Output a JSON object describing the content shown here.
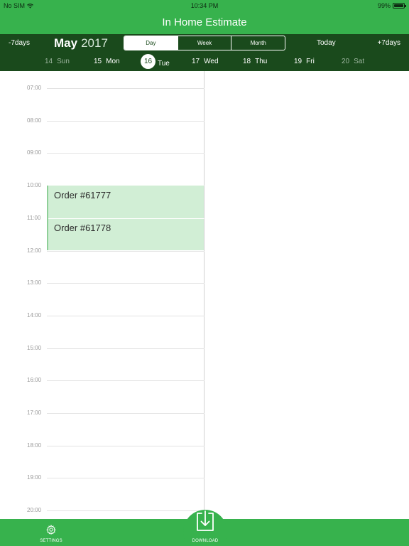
{
  "status_bar": {
    "carrier": "No SIM",
    "time": "10:34 PM",
    "battery": "99%",
    "battery_level": 0.99,
    "wifi_icon": "wifi-icon",
    "battery_icon": "battery-icon"
  },
  "title": "In Home Estimate",
  "toolbar": {
    "prev_label": "-7days",
    "month": "May",
    "year": "2017",
    "view_modes": [
      "Day",
      "Week",
      "Month"
    ],
    "active_view": "Day",
    "today_label": "Today",
    "next_label": "+7days"
  },
  "days": [
    {
      "num": "14",
      "name": "Sun",
      "muted": true,
      "selected": false
    },
    {
      "num": "15",
      "name": "Mon",
      "muted": false,
      "selected": false
    },
    {
      "num": "16",
      "name": "Tue",
      "muted": false,
      "selected": true
    },
    {
      "num": "17",
      "name": "Wed",
      "muted": false,
      "selected": false
    },
    {
      "num": "18",
      "name": "Thu",
      "muted": false,
      "selected": false
    },
    {
      "num": "19",
      "name": "Fri",
      "muted": false,
      "selected": false
    },
    {
      "num": "20",
      "name": "Sat",
      "muted": true,
      "selected": false
    }
  ],
  "hours": [
    "07:00",
    "08:00",
    "09:00",
    "10:00",
    "11:00",
    "12:00",
    "13:00",
    "14:00",
    "15:00",
    "16:00",
    "17:00",
    "18:00",
    "19:00",
    "20:00"
  ],
  "events": [
    {
      "title": "Order #61777",
      "start": "10:00",
      "end": "11:00"
    },
    {
      "title": "Order #61778",
      "start": "11:00",
      "end": "12:00"
    }
  ],
  "tabs": {
    "settings_label": "SETTINGS",
    "download_label": "DOWNLOAD",
    "settings_icon": "gear-icon",
    "download_icon": "download-icon"
  },
  "colors": {
    "accent": "#37b24d",
    "dark_bar": "#1a4a1c",
    "event_fill": "#d1eed5"
  }
}
